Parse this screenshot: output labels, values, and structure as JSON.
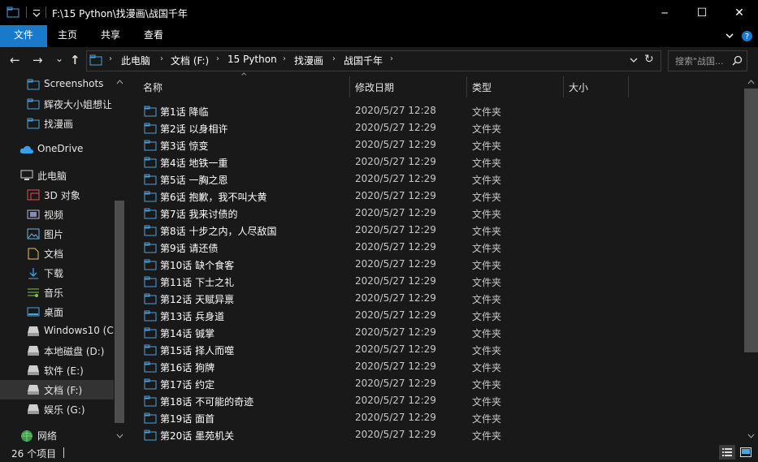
{
  "window": {
    "title": "F:\\15 Python\\找漫画\\战国千年",
    "minimize_glyph": "─",
    "maximize_glyph": "☐",
    "close_glyph": "✕"
  },
  "ribbon": {
    "tabs": [
      {
        "label": "文件",
        "active": true
      },
      {
        "label": "主页",
        "active": false
      },
      {
        "label": "共享",
        "active": false
      },
      {
        "label": "查看",
        "active": false
      }
    ]
  },
  "navigation": {
    "back_glyph": "←",
    "forward_glyph": "→",
    "recent_glyph": "⌄",
    "up_glyph": "↑",
    "breadcrumbs": [
      "此电脑",
      "文档 (F:)",
      "15 Python",
      "找漫画",
      "战国千年"
    ],
    "crumb_separator": "›",
    "search_placeholder": "搜索\"战国...",
    "refresh_glyph": "↻"
  },
  "sidebar": {
    "items": [
      {
        "label": "Screenshots",
        "icon": "folder-icon"
      },
      {
        "label": "辉夜大小姐想让",
        "icon": "folder-icon"
      },
      {
        "label": "找漫画",
        "icon": "folder-icon"
      },
      {
        "label": "OneDrive",
        "icon": "cloud-icon"
      },
      {
        "label": "此电脑",
        "icon": "computer-icon"
      },
      {
        "label": "3D 对象",
        "icon": "3d-objects-icon"
      },
      {
        "label": "视频",
        "icon": "video-icon"
      },
      {
        "label": "图片",
        "icon": "pictures-icon"
      },
      {
        "label": "文档",
        "icon": "documents-icon"
      },
      {
        "label": "下载",
        "icon": "downloads-icon"
      },
      {
        "label": "音乐",
        "icon": "music-icon"
      },
      {
        "label": "桌面",
        "icon": "desktop-icon"
      },
      {
        "label": "Windows10 (C",
        "icon": "drive-icon"
      },
      {
        "label": "本地磁盘 (D:)",
        "icon": "drive-icon"
      },
      {
        "label": "软件 (E:)",
        "icon": "drive-icon"
      },
      {
        "label": "文档 (F:)",
        "icon": "drive-icon",
        "selected": true
      },
      {
        "label": "娱乐 (G:)",
        "icon": "drive-icon"
      },
      {
        "label": "网络",
        "icon": "network-icon"
      }
    ]
  },
  "columns": {
    "name": "名称",
    "date": "修改日期",
    "type": "类型",
    "size": "大小",
    "sort_glyph": "^"
  },
  "files": [
    {
      "name": "第1话 降临",
      "date": "2020/5/27 12:28",
      "type": "文件夹"
    },
    {
      "name": "第2话 以身相许",
      "date": "2020/5/27 12:29",
      "type": "文件夹"
    },
    {
      "name": "第3话 惊变",
      "date": "2020/5/27 12:29",
      "type": "文件夹"
    },
    {
      "name": "第4话 地铁一重",
      "date": "2020/5/27 12:29",
      "type": "文件夹"
    },
    {
      "name": "第5话 一胸之恩",
      "date": "2020/5/27 12:29",
      "type": "文件夹"
    },
    {
      "name": "第6话 抱歉，我不叫大黄",
      "date": "2020/5/27 12:29",
      "type": "文件夹"
    },
    {
      "name": "第7话 我来讨债的",
      "date": "2020/5/27 12:29",
      "type": "文件夹"
    },
    {
      "name": "第8话 十步之内，人尽敌国",
      "date": "2020/5/27 12:29",
      "type": "文件夹"
    },
    {
      "name": "第9话 请还债",
      "date": "2020/5/27 12:29",
      "type": "文件夹"
    },
    {
      "name": "第10话 缺个食客",
      "date": "2020/5/27 12:29",
      "type": "文件夹"
    },
    {
      "name": "第11话 下士之礼",
      "date": "2020/5/27 12:29",
      "type": "文件夹"
    },
    {
      "name": "第12话 天赋异禀",
      "date": "2020/5/27 12:29",
      "type": "文件夹"
    },
    {
      "name": "第13话 兵身道",
      "date": "2020/5/27 12:29",
      "type": "文件夹"
    },
    {
      "name": "第14话 铖掌",
      "date": "2020/5/27 12:29",
      "type": "文件夹"
    },
    {
      "name": "第15话 择人而噬",
      "date": "2020/5/27 12:29",
      "type": "文件夹"
    },
    {
      "name": "第16话 狗牌",
      "date": "2020/5/27 12:29",
      "type": "文件夹"
    },
    {
      "name": "第17话 约定",
      "date": "2020/5/27 12:29",
      "type": "文件夹"
    },
    {
      "name": "第18话 不可能的奇迹",
      "date": "2020/5/27 12:29",
      "type": "文件夹"
    },
    {
      "name": "第19话 面首",
      "date": "2020/5/27 12:29",
      "type": "文件夹"
    },
    {
      "name": "第20话 墨苑机关",
      "date": "2020/5/27 12:29",
      "type": "文件夹"
    }
  ],
  "status": {
    "item_count": "26 个项目"
  }
}
